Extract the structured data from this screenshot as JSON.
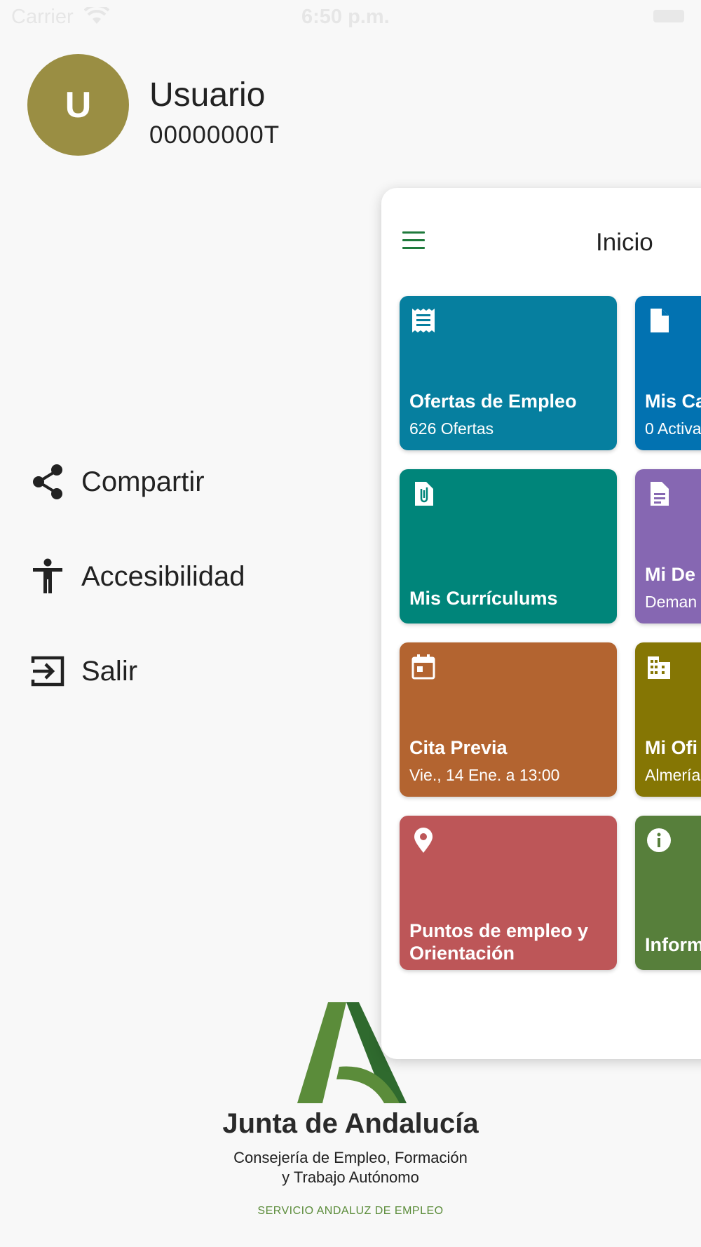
{
  "status_bar": {
    "carrier": "Carrier",
    "time": "6:50 p.m."
  },
  "profile": {
    "initial": "U",
    "name": "Usuario",
    "id": "00000000T"
  },
  "menu": [
    {
      "label": "Compartir",
      "icon": "share-icon"
    },
    {
      "label": "Accesibilidad",
      "icon": "accessibility-icon"
    },
    {
      "label": "Salir",
      "icon": "exit-icon"
    }
  ],
  "logo": {
    "title": "Junta de Andalucía",
    "line1": "Consejería de Empleo, Formación",
    "line2": "y Trabajo Autónomo",
    "line3": "SERVICIO ANDALUZ DE EMPLEO"
  },
  "panel": {
    "title": "Inicio",
    "tiles": [
      {
        "title": "Ofertas de Empleo",
        "subtitle": "626 Ofertas",
        "color": "#067f9f",
        "icon": "receipt-icon"
      },
      {
        "title": "Mis Ca",
        "subtitle": "0 Activa",
        "color": "#0272b1",
        "icon": "document-icon"
      },
      {
        "title": "Mis Currículums",
        "subtitle": "",
        "color": "#00857a",
        "icon": "attachment-file-icon"
      },
      {
        "title": "Mi De",
        "subtitle": "Deman",
        "color": "#8667b2",
        "icon": "text-document-icon"
      },
      {
        "title": "Cita Previa",
        "subtitle": "Vie., 14 Ene. a 13:00",
        "color": "#b36430",
        "icon": "calendar-icon"
      },
      {
        "title": "Mi Ofi",
        "subtitle": "Almería",
        "color": "#857604",
        "icon": "building-icon"
      },
      {
        "title": "Puntos de empleo y Orientación",
        "subtitle": "",
        "color": "#bd5658",
        "icon": "location-pin-icon"
      },
      {
        "title": "Inform",
        "subtitle": "",
        "color": "#577f3b",
        "icon": "info-icon"
      }
    ]
  },
  "colors": {
    "accent": "#1f7a3c",
    "avatar": "#9a8e43",
    "logo_green": "#5b8c3a"
  }
}
